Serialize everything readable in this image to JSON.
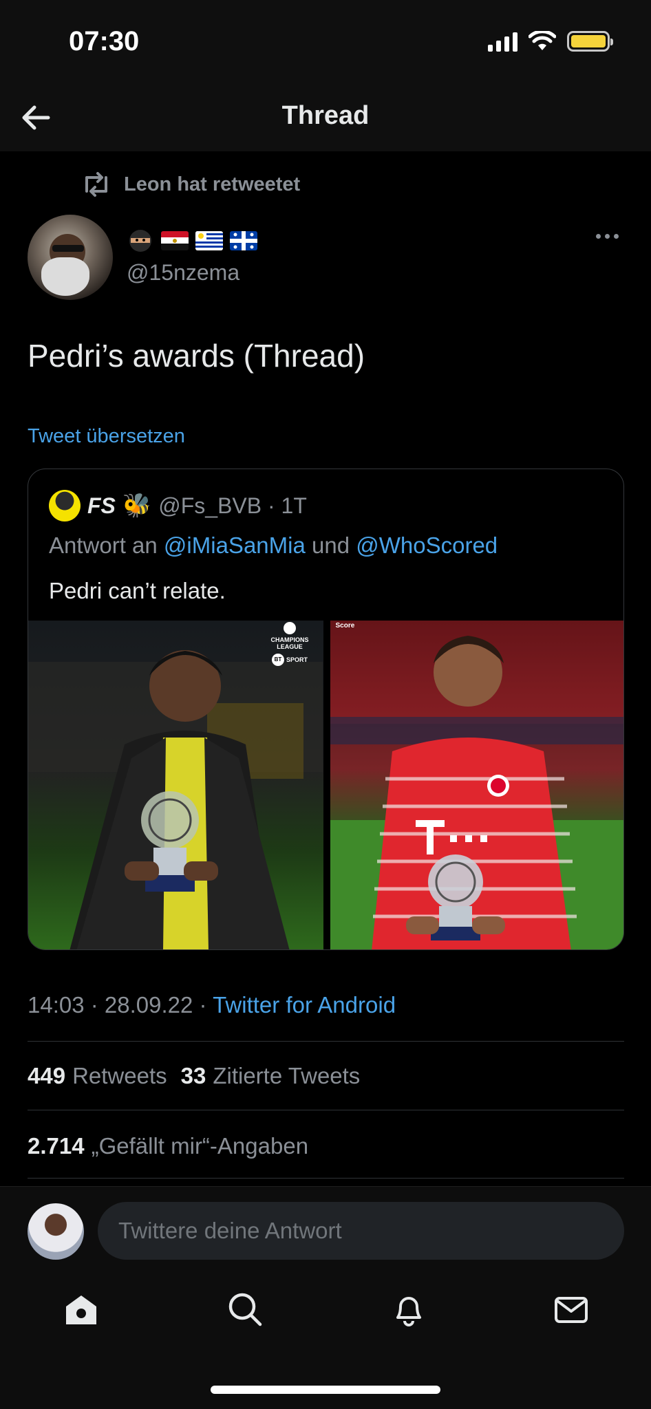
{
  "status_bar": {
    "time": "07:30",
    "battery_color": "#f5d33b"
  },
  "nav": {
    "title": "Thread",
    "back_icon": "back-arrow-icon"
  },
  "retweet": {
    "text": "Leon hat retweetet"
  },
  "tweet": {
    "handle": "@15nzema",
    "name_emojis": [
      "ninja-emoji",
      "egypt-flag",
      "uruguay-flag",
      "quebec-flag"
    ],
    "text": "Pedri’s awards (Thread)",
    "translate_label": "Tweet übersetzen",
    "timestamp": "14:03 · 28.09.22 · ",
    "client": "Twitter for Android",
    "stats": {
      "retweets_count": "449",
      "retweets_label": "Retweets",
      "quotes_count": "33",
      "quotes_label": "Zitierte Tweets",
      "likes_count": "2.714",
      "likes_label": "„Gefällt mir“-Angaben"
    }
  },
  "quote": {
    "name": "FS",
    "emoji": "🐝",
    "meta": "@Fs_BVB · 1T",
    "reply_prefix": "Antwort an ",
    "mention_1": "@iMiaSanMia",
    "reply_and": " und ",
    "mention_2": "@WhoScored",
    "text": "Pedri can’t relate.",
    "image_left_logo_lines": [
      "CHAMPIONS",
      "LEAGUE"
    ],
    "image_left_broadcaster": "SPORT",
    "image_left_broadcaster_badge": "BT",
    "image_right_watermark": "Score"
  },
  "composer": {
    "placeholder": "Twittere deine Antwort"
  },
  "tabbar": {
    "icons": [
      "home-icon",
      "search-icon",
      "notifications-icon",
      "messages-icon"
    ]
  },
  "colors": {
    "accent": "#4aa3e8",
    "background": "#000000",
    "muted_text": "#8b9097"
  }
}
